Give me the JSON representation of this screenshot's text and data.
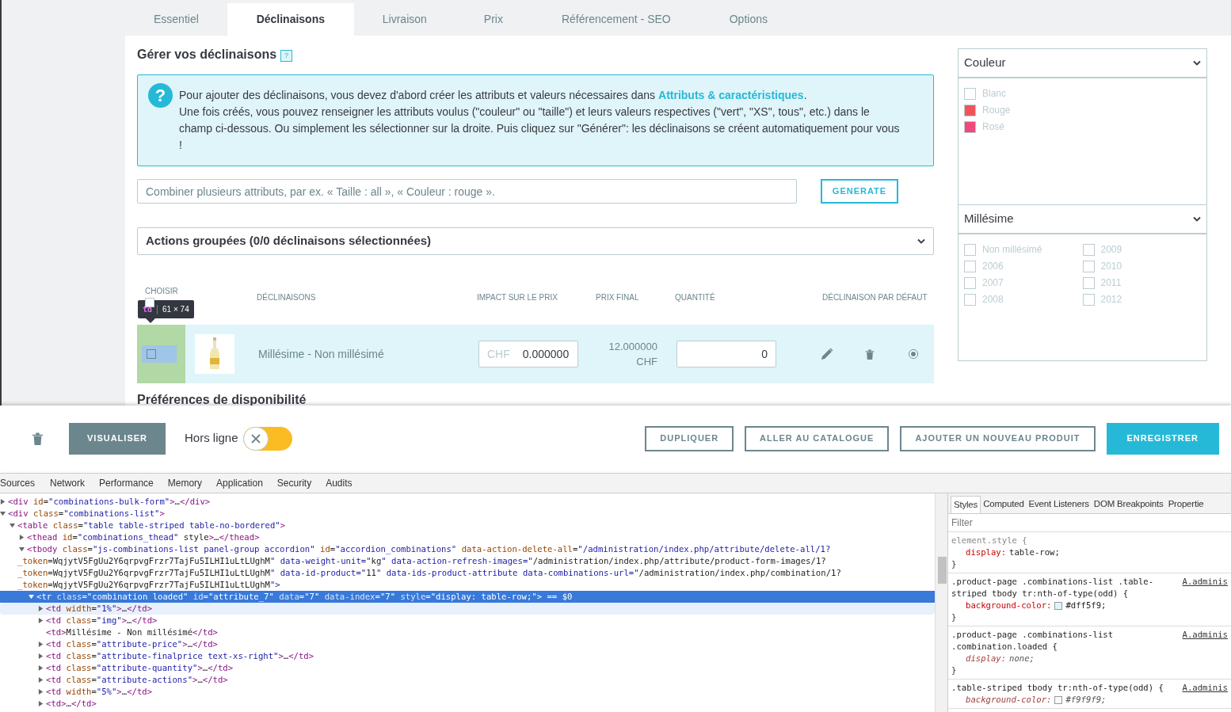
{
  "tabs": [
    {
      "label": "Essentiel",
      "selected": false
    },
    {
      "label": "Déclinaisons",
      "selected": true
    },
    {
      "label": "Livraison",
      "selected": false
    },
    {
      "label": "Prix",
      "selected": false
    },
    {
      "label": "Référencement - SEO",
      "selected": false
    },
    {
      "label": "Options",
      "selected": false
    }
  ],
  "section_title": "Gérer vos déclinaisons",
  "section_help": "?",
  "info": {
    "icon": "?",
    "text_before": "Pour ajouter des déclinaisons, vous devez d'abord créer les attributs et valeurs nécessaires dans ",
    "link": "Attributs & caractéristiques",
    "text_after": ".",
    "text_2": "Une fois créés, vous pouvez renseigner les attributs voulus (\"couleur\" ou \"taille\") et leurs valeurs respectives (\"vert\", \"XS\", tous\", etc.) dans le champ ci-dessous. Ou simplement les sélectionner sur la droite. Puis cliquez sur \"Générer\": les déclinaisons se créent automatiquement pour vous !"
  },
  "combine": {
    "placeholder": "Combiner plusieurs attributs, par ex. « Taille : all », « Couleur : rouge »."
  },
  "generate_button": "GENERATE",
  "bulk_actions": "Actions groupées (0/0 déclinaisons sélectionnées)",
  "table": {
    "select_all_checked": false,
    "columns": [
      "CHOISIR",
      "DÉCLINAISONS",
      "IMPACT SUR LE PRIX",
      "PRIX FINAL",
      "QUANTITÉ",
      "DÉCLINAISON PAR DÉFAUT"
    ],
    "rows": [
      {
        "checked": false,
        "inspected": true,
        "name": "Millésime - Non millésimé",
        "price_prefix": "CHF",
        "price": "0.000000",
        "final_price": "12.000000",
        "final_currency": "CHF",
        "quantity": "0",
        "default": true
      }
    ]
  },
  "inspect_tooltip": {
    "tag": "td",
    "size": "61 × 74"
  },
  "next_section": "Préférences de disponibilité",
  "attributes": [
    {
      "title": "Couleur",
      "kind": "color",
      "items": [
        {
          "label": "Blanc",
          "color": "#ffffff"
        },
        {
          "label": "Rouge",
          "color": "#f0545a"
        },
        {
          "label": "Rosé",
          "color": "#ee4a7a"
        }
      ]
    },
    {
      "title": "Millésime",
      "kind": "checkbox",
      "items": [
        {
          "label": "Non millésimé",
          "checked": false
        },
        {
          "label": "2006",
          "checked": false
        },
        {
          "label": "2007",
          "checked": false
        },
        {
          "label": "2008",
          "checked": false
        },
        {
          "label": "2009",
          "checked": false
        },
        {
          "label": "2010",
          "checked": false
        },
        {
          "label": "2011",
          "checked": false
        },
        {
          "label": "2012",
          "checked": false
        }
      ]
    }
  ],
  "footer": {
    "preview_button": "VISUALISER",
    "offline_toggle": {
      "label": "Hors ligne",
      "on": false
    },
    "buttons": [
      {
        "label": "DUPLIQUER",
        "kind": "outline"
      },
      {
        "label": "ALLER AU CATALOGUE",
        "kind": "outline"
      },
      {
        "label": "AJOUTER UN NOUVEAU PRODUIT",
        "kind": "outline"
      },
      {
        "label": "ENREGISTRER",
        "kind": "primary"
      }
    ]
  },
  "devtools": {
    "tabs": [
      {
        "label": "Sources",
        "selected": false
      },
      {
        "label": "Network",
        "selected": false
      },
      {
        "label": "Performance",
        "selected": false
      },
      {
        "label": "Memory",
        "selected": false
      },
      {
        "label": "Application",
        "selected": false
      },
      {
        "label": "Security",
        "selected": false
      },
      {
        "label": "Audits",
        "selected": false
      }
    ],
    "dom_tree": [
      {
        "lines": [
          "<div id=\"combinations-bulk-form\">…</div>"
        ],
        "kind": "element",
        "expanded": false,
        "selected": false,
        "hovered": false
      },
      {
        "lines": [
          "<div class=\"combinations-list\">"
        ],
        "kind": "element",
        "expanded": true,
        "selected": false,
        "hovered": false,
        "children": [
          {
            "lines": [
              "<table class=\"table table-striped table-no-bordered\">"
            ],
            "kind": "element",
            "expanded": true,
            "selected": false,
            "hovered": false,
            "children": [
              {
                "lines": [
                  "<thead id=\"combinations_thead\" style>…</thead>"
                ],
                "kind": "element",
                "expanded": false,
                "selected": false,
                "hovered": false
              },
              {
                "lines": [
                  "<tbody class=\"js-combinations-list panel-group accordion\" id=\"accordion_combinations\" data-action-delete-all=\"/administration/index.php/attribute/delete-all/1?",
                  "_token=WqjytV5FgUu2Y6qrpvgFrzr7TajFu5ILHI1uLtLUghM\" data-weight-unit=\"kg\" data-action-refresh-images=\"/administration/index.php/attribute/product-form-images/1?",
                  "_token=WqjytV5FgUu2Y6qrpvgFrzr7TajFu5ILHI1uLtLUghM\" data-id-product=\"11\" data-ids-product-attribute data-combinations-url=\"/administration/index.php/combination/1?",
                  "_token=WqjytV5FgUu2Y6qrpvgFrzr7TajFu5ILHI1uLtLUghM\">"
                ],
                "kind": "element",
                "expanded": true,
                "selected": false,
                "hovered": false,
                "children": [
                  {
                    "lines": [
                      "<tr class=\"combination loaded\" id=\"attribute_7\" data=\"7\" data-index=\"7\" style=\"display: table-row;\"> == $0"
                    ],
                    "kind": "element",
                    "expanded": true,
                    "selected": true,
                    "hovered": false,
                    "children": [
                      {
                        "lines": [
                          "<td width=\"1%\">…</td>"
                        ],
                        "kind": "element",
                        "expanded": false,
                        "selected": false,
                        "hovered": true
                      },
                      {
                        "lines": [
                          "<td class=\"img\">…</td>"
                        ],
                        "kind": "element",
                        "expanded": false,
                        "selected": false,
                        "hovered": false
                      },
                      {
                        "lines": [
                          "<td>Millésime - Non millésimé</td>"
                        ],
                        "kind": "text",
                        "selected": false,
                        "hovered": false
                      },
                      {
                        "lines": [
                          "<td class=\"attribute-price\">…</td>"
                        ],
                        "kind": "element",
                        "expanded": false,
                        "selected": false,
                        "hovered": false
                      },
                      {
                        "lines": [
                          "<td class=\"attribute-finalprice text-xs-right\">…</td>"
                        ],
                        "kind": "element",
                        "expanded": false,
                        "selected": false,
                        "hovered": false
                      },
                      {
                        "lines": [
                          "<td class=\"attribute-quantity\">…</td>"
                        ],
                        "kind": "element",
                        "expanded": false,
                        "selected": false,
                        "hovered": false
                      },
                      {
                        "lines": [
                          "<td class=\"attribute-actions\">…</td>"
                        ],
                        "kind": "element",
                        "expanded": false,
                        "selected": false,
                        "hovered": false
                      },
                      {
                        "lines": [
                          "<td width=\"5%\">…</td>"
                        ],
                        "kind": "element",
                        "expanded": false,
                        "selected": false,
                        "hovered": false
                      },
                      {
                        "lines": [
                          "<td>…</td>"
                        ],
                        "kind": "element",
                        "expanded": false,
                        "selected": false,
                        "hovered": false
                      }
                    ]
                  }
                ]
              }
            ]
          }
        ]
      }
    ],
    "styles_tabs": [
      {
        "label": "Styles",
        "selected": true
      },
      {
        "label": "Computed",
        "selected": false
      },
      {
        "label": "Event Listeners",
        "selected": false
      },
      {
        "label": "DOM Breakpoints",
        "selected": false
      },
      {
        "label": "Propertie",
        "selected": false
      }
    ],
    "filter": {
      "placeholder": "Filter"
    },
    "rules": [
      {
        "selector": "element.style {",
        "declarations": [
          {
            "property": "display:",
            "value": "table-row;",
            "overridden": false
          }
        ],
        "close": "}"
      },
      {
        "selector": ".product-page .combinations-list .table-striped tbody tr:nth-of-type(odd) {",
        "source": "A.adminis",
        "declarations": [
          {
            "property": "background-color:",
            "value": "#dff5f9;",
            "swatch": true,
            "overridden": false
          }
        ],
        "close": "}"
      },
      {
        "selector": ".product-page .combinations-list .combination.loaded {",
        "source": "A.adminis",
        "declarations": [
          {
            "property": "display:",
            "value": "none;",
            "overridden": true
          }
        ],
        "close": "}"
      },
      {
        "selector": ".table-striped tbody tr:nth-of-type(odd) {",
        "source": "A.adminis",
        "declarations": [
          {
            "property": "background-color:",
            "value": "#f9f9f9;",
            "swatch": true,
            "overridden": true
          }
        ]
      }
    ]
  }
}
